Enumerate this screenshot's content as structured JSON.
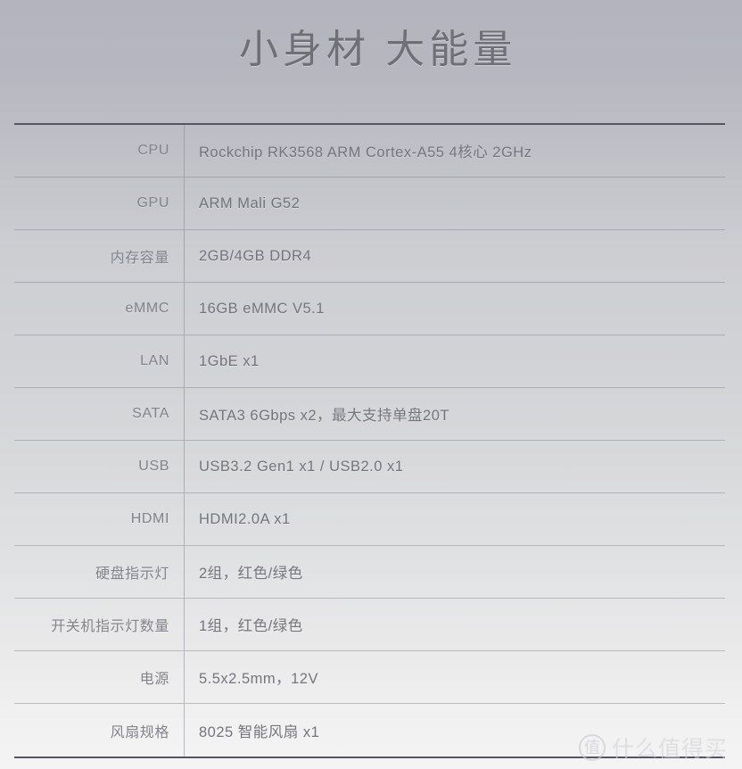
{
  "page": {
    "title": "小身材 大能量",
    "background_top_color": "#b3b4be",
    "background_bottom_color": "#f4f4f4",
    "label_color": "#82838b",
    "value_color": "#74757c",
    "border_color": "#55555f"
  },
  "spec_table": {
    "rows": [
      {
        "label": "CPU",
        "value": "Rockchip RK3568 ARM Cortex-A55 4核心 2GHz"
      },
      {
        "label": "GPU",
        "value": "ARM Mali G52"
      },
      {
        "label": "内存容量",
        "value": "2GB/4GB DDR4"
      },
      {
        "label": "eMMC",
        "value": "16GB eMMC V5.1"
      },
      {
        "label": "LAN",
        "value": "1GbE x1"
      },
      {
        "label": "SATA",
        "value": "SATA3 6Gbps x2，最大支持单盘20T"
      },
      {
        "label": "USB",
        "value": "USB3.2 Gen1 x1 / USB2.0 x1"
      },
      {
        "label": "HDMI",
        "value": "HDMI2.0A x1"
      },
      {
        "label": "硬盘指示灯",
        "value": "2组，红色/绿色"
      },
      {
        "label": "开关机指示灯数量",
        "value": "1组，红色/绿色"
      },
      {
        "label": "电源",
        "value": "5.5x2.5mm，12V"
      },
      {
        "label": "风扇规格",
        "value": "8025 智能风扇 x1"
      }
    ]
  },
  "watermark": {
    "badge": "值",
    "text": "什么值得买"
  }
}
